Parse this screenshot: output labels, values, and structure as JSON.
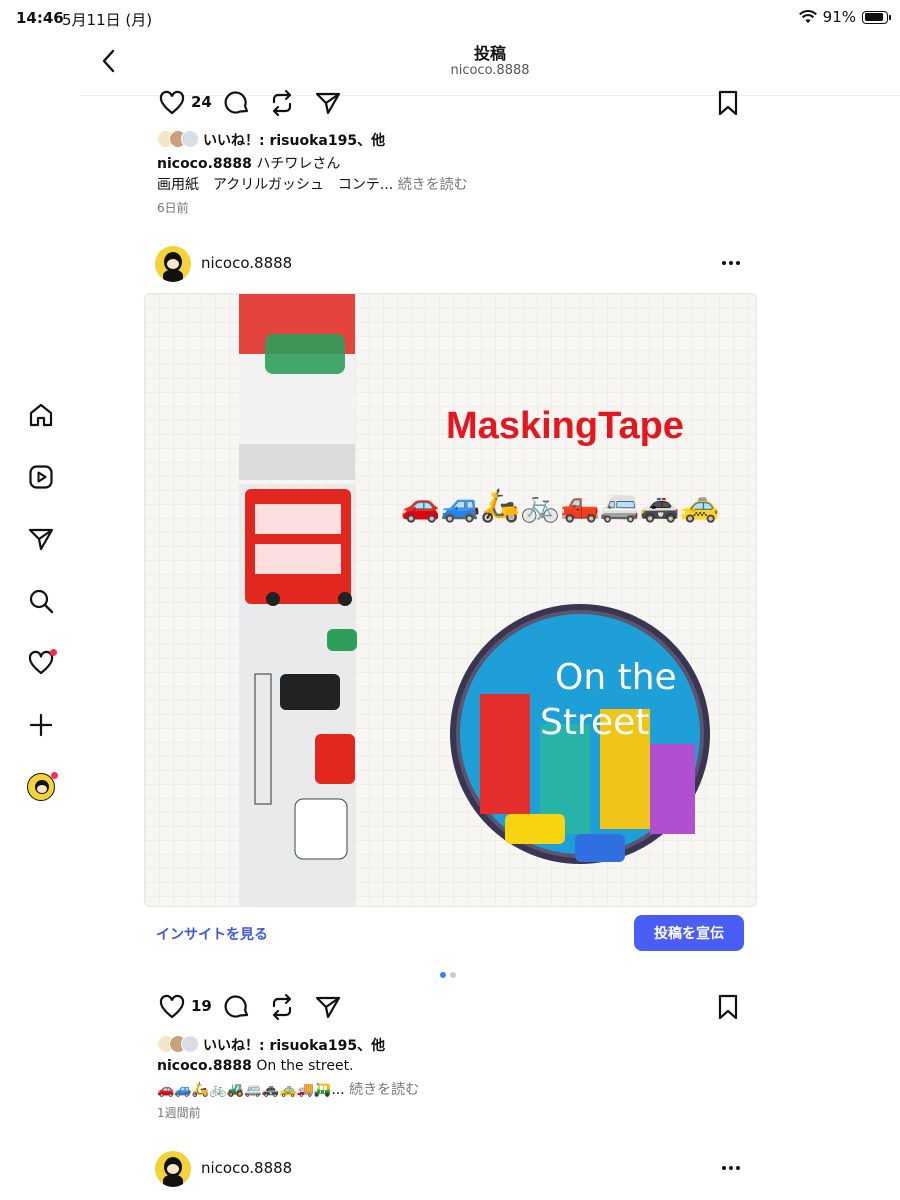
{
  "status": {
    "time": "14:46",
    "date": "5月11日 (月)",
    "battery": "91%"
  },
  "header": {
    "title": "投稿",
    "subtitle": "nicoco.8888"
  },
  "post1": {
    "likes": "24",
    "liked_by": "いいね！: risuoka195、他",
    "username": "nicoco.8888",
    "caption": "ハチワレさん",
    "caption2": "画用紙　アクリルガッシュ　コンテ...",
    "more": "続きを読む",
    "time": "6日前"
  },
  "post2": {
    "username": "nicoco.8888",
    "image": {
      "title": "MaskingTape",
      "emoji_row": "🚗🚙🛵🚲🛻🚐🚓🚕",
      "roll_text_1": "On the",
      "roll_text_2": "Street"
    },
    "insight": "インサイトを見る",
    "promote": "投稿を宣伝",
    "likes": "19",
    "liked_by": "いいね！: risuoka195、他",
    "caption": "On the street.",
    "caption2": "🚗🚙🛵🚲🚜🚐🚓🚕🚚🛺...",
    "more": "続きを読む",
    "time": "1週間前"
  },
  "post3": {
    "username": "nicoco.8888"
  },
  "colors": {
    "accent": "#4a5ef6",
    "link": "#3b5bdb",
    "notify": "#ff2d55",
    "title_red": "#e5161e"
  }
}
